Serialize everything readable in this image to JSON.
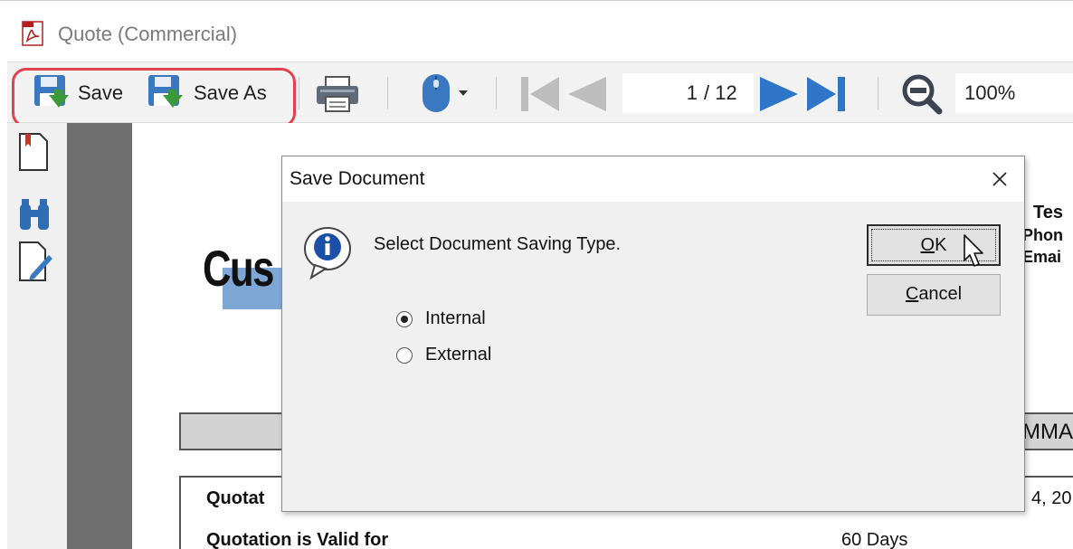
{
  "window": {
    "title": "Quote (Commercial)",
    "icon": "pdf-document-icon"
  },
  "toolbar": {
    "save_label": "Save",
    "save_as_label": "Save As",
    "print_icon": "printer-icon",
    "mouse_icon": "mouse-icon",
    "first_page_icon": "first-page-icon",
    "prev_page_icon": "previous-page-icon",
    "current_page": "1",
    "total_pages": "/ 12",
    "next_page_icon": "next-page-icon",
    "last_page_icon": "last-page-icon",
    "zoom_icon": "zoom-out-icon",
    "zoom_level": "100%",
    "highlight_color": "#e0434f"
  },
  "sidebar": {
    "items": [
      {
        "icon": "bookmark-page-icon"
      },
      {
        "icon": "binoculars-search-icon"
      },
      {
        "icon": "edit-document-icon"
      }
    ]
  },
  "document": {
    "heading_fragment": "Cus",
    "header_right": [
      "Tes",
      "Phon",
      "Emai"
    ],
    "summary_fragment": "MMA",
    "quote_label": "Quotat",
    "date_fragment": "4, 20",
    "valid_label": "Quotation is Valid for",
    "valid_value": "60 Days"
  },
  "dialog": {
    "title": "Save Document",
    "message": "Select Document Saving Type.",
    "ok_mnemonic": "O",
    "ok_rest": "K",
    "cancel_mnemonic": "C",
    "cancel_rest": "ancel",
    "options": [
      {
        "label": "Internal",
        "selected": true
      },
      {
        "label": "External",
        "selected": false
      }
    ]
  }
}
